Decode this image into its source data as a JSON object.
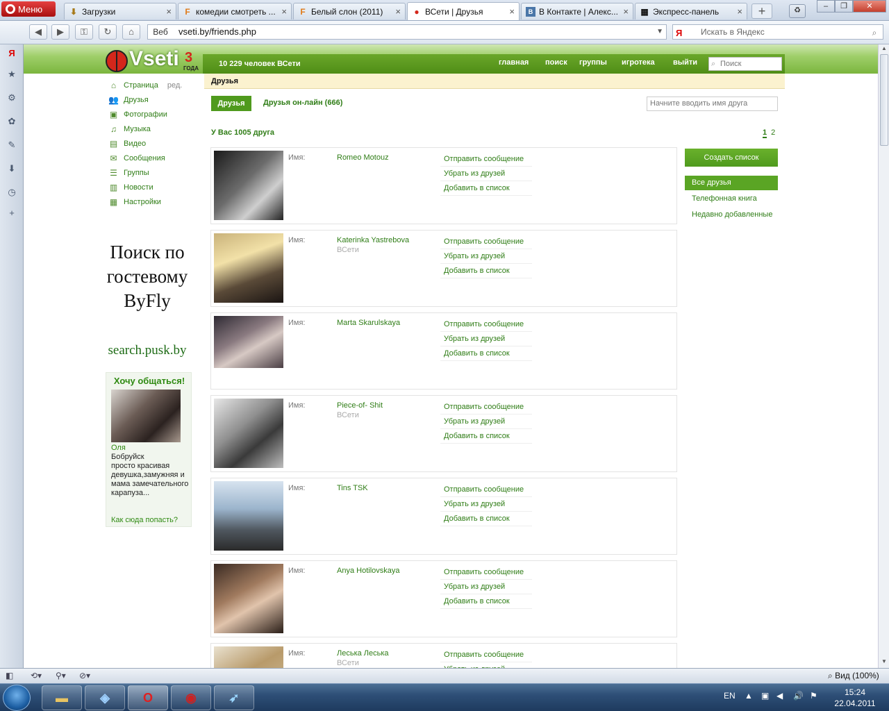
{
  "browser": {
    "menu_label": "Меню",
    "tabs": [
      {
        "label": "Загрузки",
        "icon": "download-icon"
      },
      {
        "label": "комедии смотреть ...",
        "icon": "f-site-icon"
      },
      {
        "label": "Белый слон (2011)",
        "icon": "f-site-icon"
      },
      {
        "label": "ВСети | Друзья",
        "icon": "vseti-icon",
        "active": true
      },
      {
        "label": "В Контакте | Алекс...",
        "icon": "vk-icon"
      },
      {
        "label": "Экспресс-панель",
        "icon": "grid-icon"
      }
    ],
    "address": {
      "web_label": "Веб",
      "url": "vseti.by/friends.php"
    },
    "search_placeholder": "Искать в Яндекс",
    "search_engine_label": "Я",
    "zoom_label": "Вид (100%)"
  },
  "site": {
    "logo_word": "Vseti",
    "logo_number": "3",
    "logo_sub": "ГОДА",
    "users_count": "10 229 человек ВСети",
    "nav": [
      "главная",
      "поиск",
      "группы",
      "игротека",
      "выйти"
    ],
    "search_placeholder": "Поиск",
    "sidebar": [
      {
        "label": "Страница",
        "extra": "ред.",
        "icon": "home-icon"
      },
      {
        "label": "Друзья",
        "icon": "friends-icon"
      },
      {
        "label": "Фотографии",
        "icon": "photo-icon"
      },
      {
        "label": "Музыка",
        "icon": "headphones-icon"
      },
      {
        "label": "Видео",
        "icon": "video-icon"
      },
      {
        "label": "Сообщения",
        "icon": "message-icon"
      },
      {
        "label": "Группы",
        "icon": "groups-icon"
      },
      {
        "label": "Новости",
        "icon": "news-icon"
      },
      {
        "label": "Настройки",
        "icon": "settings-icon"
      }
    ],
    "ad": {
      "lines": [
        "Поиск по",
        "гостевому",
        "ByFly"
      ],
      "link": "search.pusk.by"
    },
    "promo": {
      "title": "Хочу общаться!",
      "name": "Оля",
      "city": "Бобруйск",
      "text": "просто красивая девушка,замужняя и мама замечательного карапуза...",
      "link": "Как сюда попасть?"
    }
  },
  "main": {
    "section_title": "Друзья",
    "tab_friends": "Друзья",
    "tab_online": "Друзья он-лайн (666)",
    "filter_placeholder": "Начните вводить имя друга",
    "friends_count": "У Вас 1005 друга",
    "pages": [
      "1",
      "2"
    ],
    "name_label": "Имя:",
    "actions": [
      "Отправить сообщение",
      "Убрать из друзей",
      "Добавить в список"
    ],
    "friends": [
      {
        "name": "Romeo Motouz",
        "sub": ""
      },
      {
        "name": "Katerinka Yastrebova",
        "sub": "ВСети"
      },
      {
        "name": "Marta Skarulskaya",
        "sub": ""
      },
      {
        "name": "Piece-of- Shit",
        "sub": "ВСети"
      },
      {
        "name": "Tins TSK",
        "sub": ""
      },
      {
        "name": "Anya Hotilovskaya",
        "sub": ""
      },
      {
        "name": "Леська Леська",
        "sub": "ВСети"
      }
    ],
    "create_list_label": "Создать список",
    "lists": [
      "Все друзья",
      "Телефонная книга",
      "Недавно добавленные"
    ]
  },
  "taskbar": {
    "lang": "EN",
    "time": "15:24",
    "date": "22.04.2011"
  },
  "colors": {
    "accent": "#4f9a1d",
    "link": "#2f7d16",
    "header_yellow": "#fbf2cf"
  }
}
